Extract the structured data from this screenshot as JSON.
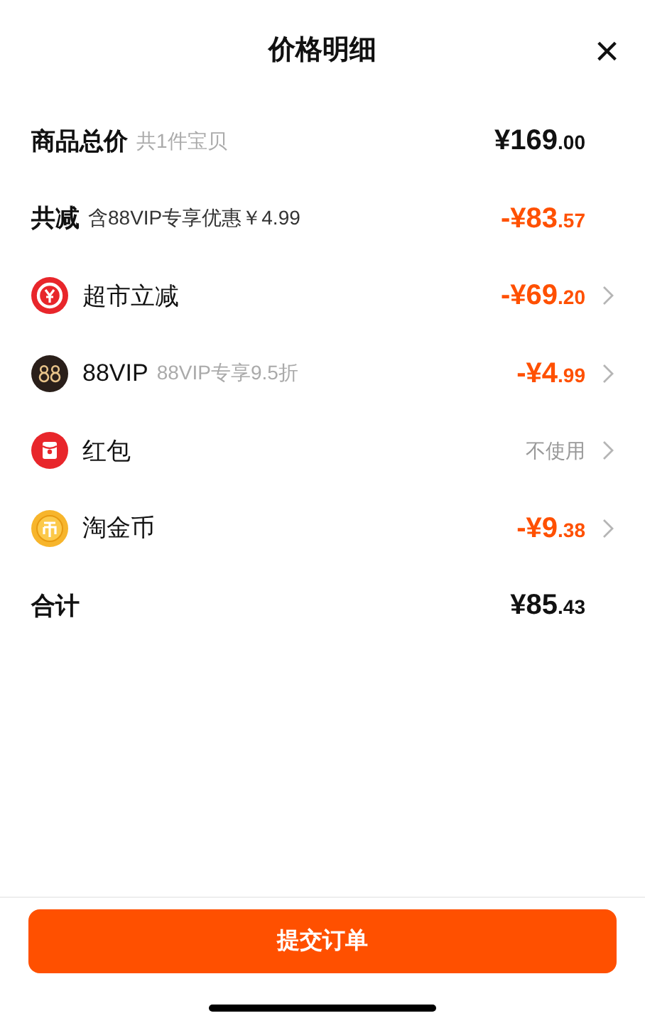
{
  "header": {
    "title": "价格明细",
    "close": "×"
  },
  "rows": [
    {
      "kind": "total",
      "label": "商品总价",
      "note": "共1件宝贝",
      "amount_main": "¥169",
      "amount_cents": ".00"
    },
    {
      "kind": "summary",
      "label": "共减",
      "note": "含88VIP专享优惠￥4.99",
      "amount_main": "-¥83",
      "amount_cents": ".57"
    },
    {
      "kind": "item",
      "label": "超市立减",
      "amount_main": "-¥69",
      "amount_cents": ".20"
    },
    {
      "kind": "item",
      "label": "88VIP",
      "note": "88VIP专享9.5折",
      "amount_main": "-¥4",
      "amount_cents": ".99"
    },
    {
      "kind": "item",
      "label": "红包",
      "value": "不使用"
    },
    {
      "kind": "item",
      "label": "淘金币",
      "amount_main": "-¥9",
      "amount_cents": ".38"
    },
    {
      "kind": "total",
      "label": "合计",
      "amount_main": "¥85",
      "amount_cents": ".43"
    }
  ],
  "submit_button": "提交订单"
}
